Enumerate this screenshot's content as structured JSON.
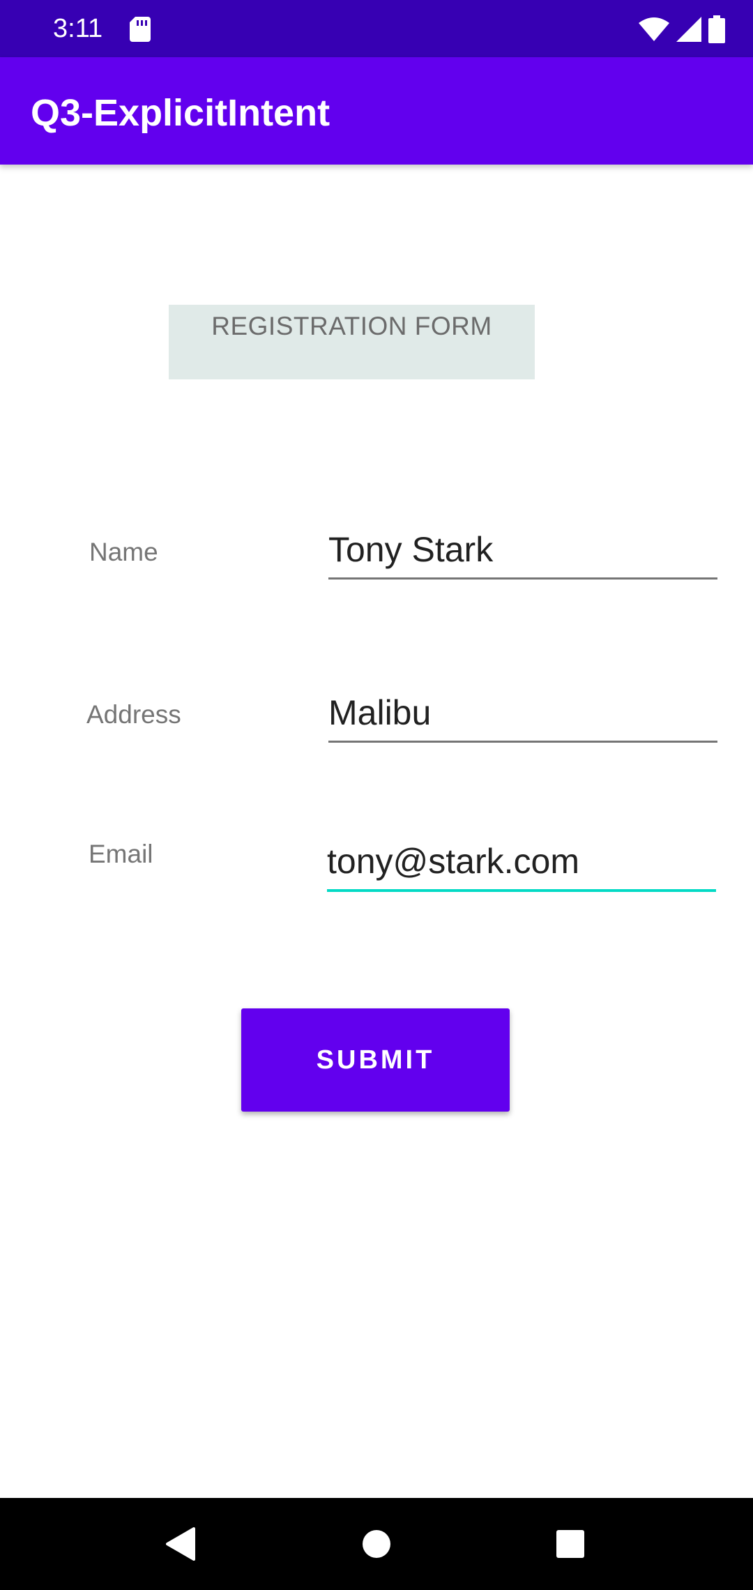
{
  "status_bar": {
    "time": "3:11",
    "icons": [
      "sd-card-icon",
      "wifi-icon",
      "signal-icon",
      "battery-icon"
    ]
  },
  "app_bar": {
    "title": "Q3-ExplicitIntent"
  },
  "form": {
    "heading": "REGISTRATION FORM",
    "fields": [
      {
        "label": "Name",
        "value": "Tony Stark",
        "focused": false
      },
      {
        "label": "Address",
        "value": "Malibu",
        "focused": false
      },
      {
        "label": "Email",
        "value": "tony@stark.com",
        "focused": true
      }
    ],
    "submit_label": "SUBMIT"
  },
  "nav_bar": {
    "icons": [
      "back-icon",
      "home-icon",
      "recents-icon"
    ]
  },
  "colors": {
    "status_bar": "#3700b3",
    "primary": "#6200ee",
    "accent": "#03dac5",
    "heading_bg": "#e0eae8"
  }
}
